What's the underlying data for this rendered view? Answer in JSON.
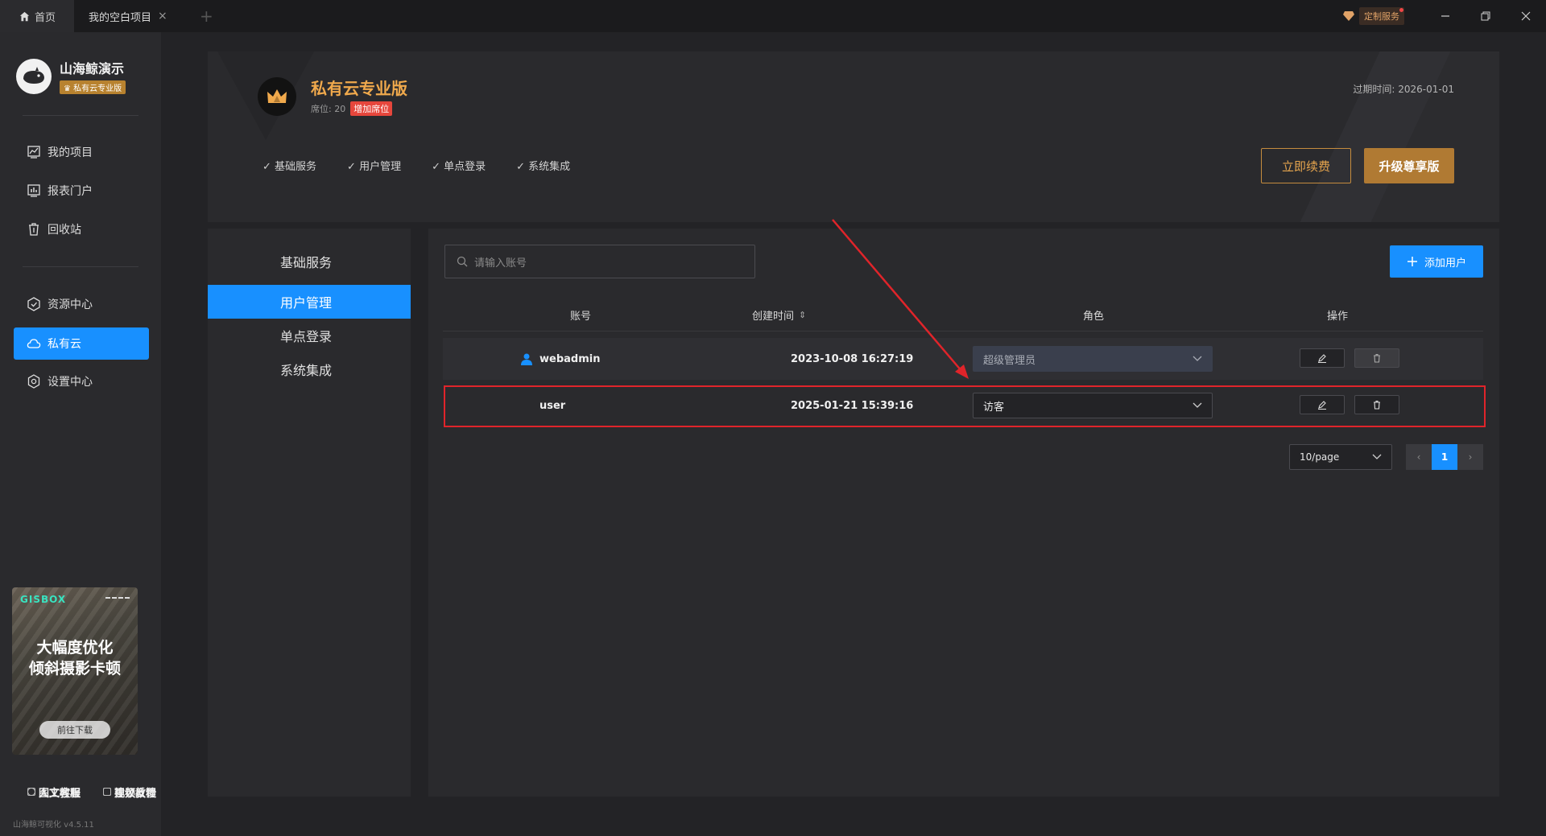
{
  "titlebar": {
    "home_tab": "首页",
    "project_tab": "我的空白项目",
    "close_glyph": "×",
    "add_glyph": "+",
    "custom_service": "定制服务"
  },
  "sidebar": {
    "brand_name": "山海鲸演示",
    "brand_badge": "♛ 私有云专业版",
    "items": [
      {
        "label": "我的项目",
        "icon": "chart-icon"
      },
      {
        "label": "报表门户",
        "icon": "report-icon"
      },
      {
        "label": "回收站",
        "icon": "trash-icon"
      },
      {
        "label": "资源中心",
        "icon": "resource-icon"
      },
      {
        "label": "私有云",
        "icon": "cloud-icon"
      },
      {
        "label": "设置中心",
        "icon": "settings-icon"
      }
    ],
    "active_item": "私有云",
    "promo": {
      "brand": "GISBOX",
      "line1": "大幅度优化",
      "line2": "倾斜摄影卡顿",
      "download": "前往下载"
    },
    "help": {
      "tutorial_text": "图文教程",
      "tutorial_video": "视频教程",
      "support": "人工客服",
      "feedback": "建议反馈"
    },
    "version": "山海鲸可视化 v4.5.11"
  },
  "header": {
    "plan_title": "私有云专业版",
    "seats": "席位: 20",
    "add_seats": "增加席位",
    "features": [
      "基础服务",
      "用户管理",
      "单点登录",
      "系统集成"
    ],
    "expire": "过期时间:  2026-01-01",
    "renew_button": "立即续费",
    "upgrade_button": "升级尊享版"
  },
  "menu": {
    "items": [
      "基础服务",
      "用户管理",
      "单点登录",
      "系统集成"
    ],
    "active": "用户管理"
  },
  "users": {
    "search_placeholder": "请输入账号",
    "add_button": "添加用户",
    "columns": {
      "account": "账号",
      "created": "创建时间",
      "sort_glyph": "⇕",
      "role": "角色",
      "actions": "操作"
    },
    "rows": [
      {
        "account": "webadmin",
        "created": "2023-10-08 16:27:19",
        "role": "超级管理员",
        "role_disabled": true,
        "is_self": true
      },
      {
        "account": "user",
        "created": "2025-01-21 15:39:16",
        "role": "访客",
        "role_disabled": false,
        "is_self": false
      }
    ],
    "page_size": "10/page",
    "current_page": "1",
    "prev_glyph": "‹",
    "next_glyph": "›"
  },
  "colors": {
    "accent": "#1890ff",
    "gold": "#b07a33",
    "highlight": "#e0242a"
  }
}
